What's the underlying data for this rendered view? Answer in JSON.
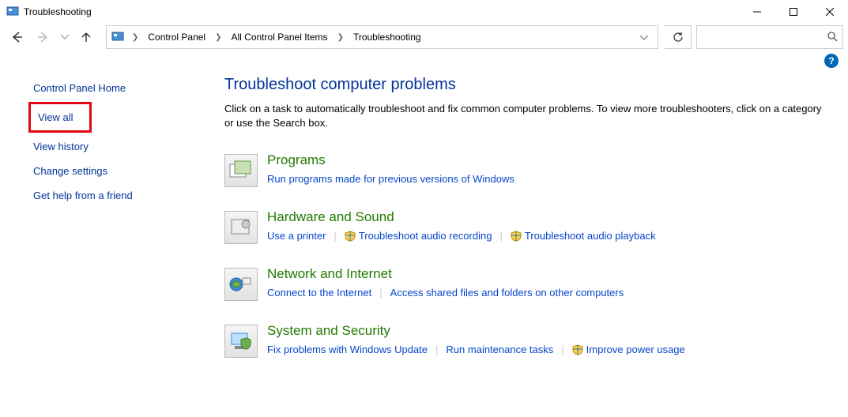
{
  "window": {
    "title": "Troubleshooting"
  },
  "breadcrumb": {
    "items": [
      "Control Panel",
      "All Control Panel Items",
      "Troubleshooting"
    ]
  },
  "sidebar": {
    "items": [
      {
        "label": "Control Panel Home",
        "highlighted": false
      },
      {
        "label": "View all",
        "highlighted": true
      },
      {
        "label": "View history",
        "highlighted": false
      },
      {
        "label": "Change settings",
        "highlighted": false
      },
      {
        "label": "Get help from a friend",
        "highlighted": false
      }
    ]
  },
  "main": {
    "heading": "Troubleshoot computer problems",
    "description": "Click on a task to automatically troubleshoot and fix common computer problems. To view more troubleshooters, click on a category or use the Search box.",
    "categories": [
      {
        "title": "Programs",
        "tasks": [
          {
            "label": "Run programs made for previous versions of Windows",
            "shield": false
          }
        ]
      },
      {
        "title": "Hardware and Sound",
        "tasks": [
          {
            "label": "Use a printer",
            "shield": false
          },
          {
            "label": "Troubleshoot audio recording",
            "shield": true
          },
          {
            "label": "Troubleshoot audio playback",
            "shield": true
          }
        ]
      },
      {
        "title": "Network and Internet",
        "tasks": [
          {
            "label": "Connect to the Internet",
            "shield": false
          },
          {
            "label": "Access shared files and folders on other computers",
            "shield": false
          }
        ]
      },
      {
        "title": "System and Security",
        "tasks": [
          {
            "label": "Fix problems with Windows Update",
            "shield": false
          },
          {
            "label": "Run maintenance tasks",
            "shield": false
          },
          {
            "label": "Improve power usage",
            "shield": true
          }
        ]
      }
    ]
  }
}
